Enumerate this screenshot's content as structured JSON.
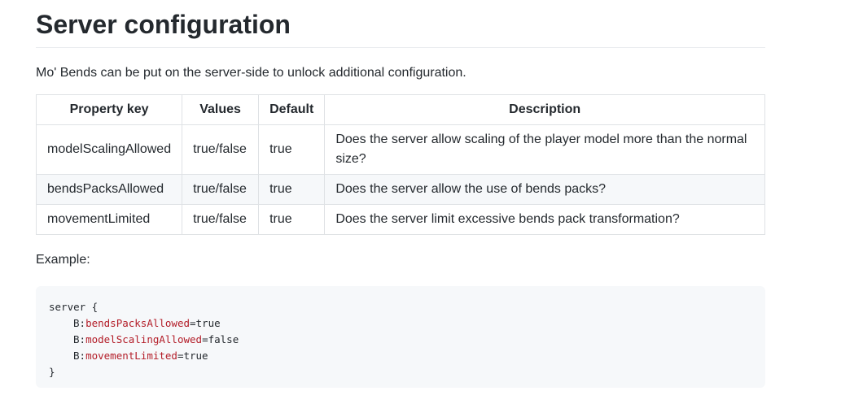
{
  "page": {
    "title": "Server configuration",
    "intro": "Mo' Bends can be put on the server-side to unlock additional configuration.",
    "example_label": "Example:"
  },
  "table": {
    "headers": [
      "Property key",
      "Values",
      "Default",
      "Description"
    ],
    "rows": [
      {
        "key": "modelScalingAllowed",
        "values": "true/false",
        "default": "true",
        "description": "Does the server allow scaling of the player model more than the normal size?"
      },
      {
        "key": "bendsPacksAllowed",
        "values": "true/false",
        "default": "true",
        "description": "Does the server allow the use of bends packs?"
      },
      {
        "key": "movementLimited",
        "values": "true/false",
        "default": "true",
        "description": "Does the server limit excessive bends pack transformation?"
      }
    ]
  },
  "code": {
    "open": "server {",
    "prefix": "B:",
    "lines": [
      {
        "key": "bendsPacksAllowed",
        "value": "=true"
      },
      {
        "key": "modelScalingAllowed",
        "value": "=false"
      },
      {
        "key": "movementLimited",
        "value": "=true"
      }
    ],
    "close": "}"
  },
  "colors": {
    "text": "#24292e",
    "border": "#dfe2e5",
    "stripe": "#f6f8fa",
    "code_bg": "#f6f8fa",
    "code_key": "#b31d28"
  }
}
